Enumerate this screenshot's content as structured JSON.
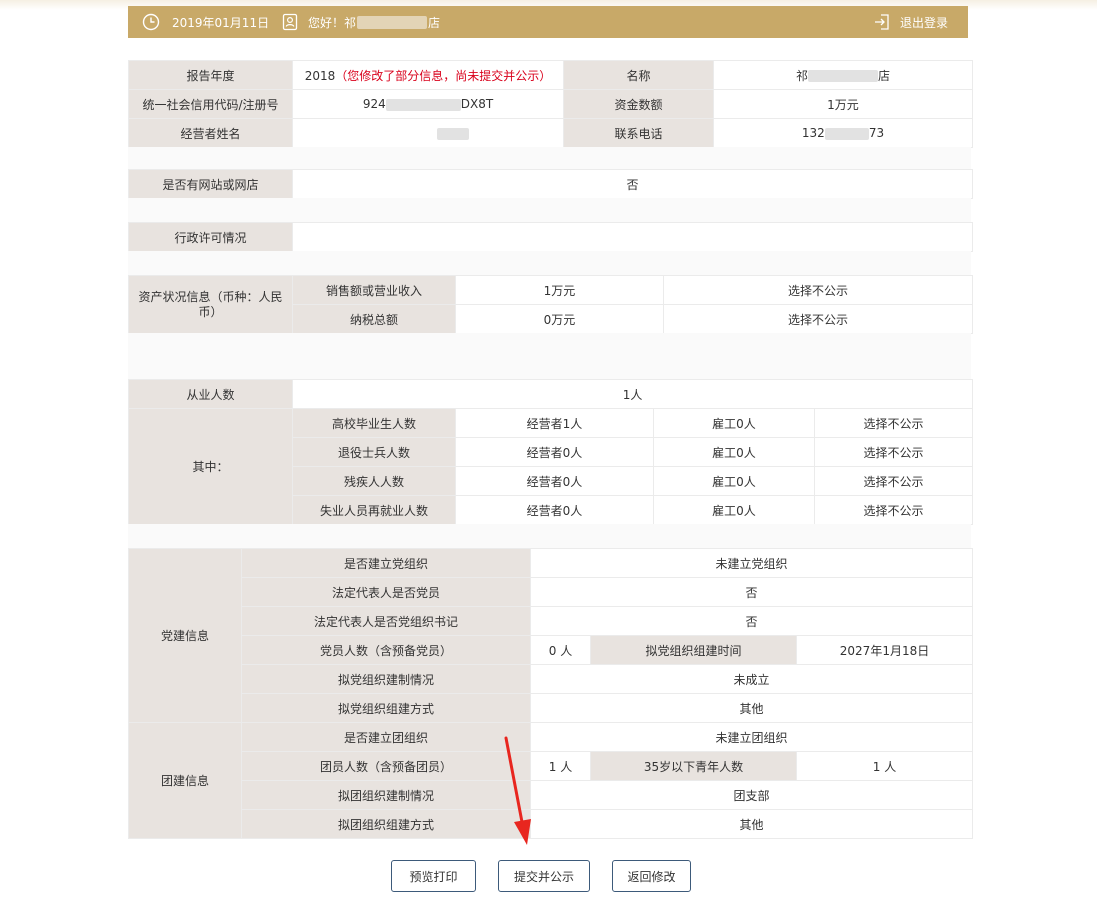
{
  "header": {
    "date": "2019年01月11日",
    "greeting_prefix": "您好！祁",
    "greeting_suffix": "店",
    "logout_label": "退出登录",
    "color": "#c8a968"
  },
  "basic": {
    "report_year_label": "报告年度",
    "report_year_value": "2018",
    "report_year_note": "（您修改了部分信息，尚未提交并公示）",
    "name_label": "名称",
    "name_prefix": "祁",
    "name_suffix": "店",
    "credit_code_label": "统一社会信用代码/注册号",
    "credit_code_prefix": "924",
    "credit_code_suffix": "DX8T",
    "capital_label": "资金数额",
    "capital_value": "1万元",
    "operator_label": "经营者姓名",
    "phone_label": "联系电话",
    "phone_prefix": "132",
    "phone_suffix": "73"
  },
  "website": {
    "label": "是否有网站或网店",
    "value": "否"
  },
  "license": {
    "label": "行政许可情况",
    "value": ""
  },
  "assets": {
    "label": "资产状况信息（币种：人民币）",
    "rows": [
      {
        "label": "销售额或营业收入",
        "value": "1万元",
        "publicity": "选择不公示"
      },
      {
        "label": "纳税总额",
        "value": "0万元",
        "publicity": "选择不公示"
      }
    ]
  },
  "employees": {
    "label": "从业人数",
    "value": "1人",
    "sub_label": "其中：",
    "rows": [
      {
        "label": "高校毕业生人数",
        "operator": "经营者1人",
        "staff": "雇工0人",
        "publicity": "选择不公示"
      },
      {
        "label": "退役士兵人数",
        "operator": "经营者0人",
        "staff": "雇工0人",
        "publicity": "选择不公示"
      },
      {
        "label": "残疾人人数",
        "operator": "经营者0人",
        "staff": "雇工0人",
        "publicity": "选择不公示"
      },
      {
        "label": "失业人员再就业人数",
        "operator": "经营者0人",
        "staff": "雇工0人",
        "publicity": "选择不公示"
      }
    ]
  },
  "party": {
    "label": "党建信息",
    "org_label": "是否建立党组织",
    "org_value": "未建立党组织",
    "rep_member_label": "法定代表人是否党员",
    "rep_member_value": "否",
    "rep_secretary_label": "法定代表人是否党组织书记",
    "rep_secretary_value": "否",
    "members_label": "党员人数（含预备党员）",
    "members_value": "0 人",
    "plan_time_label": "拟党组织组建时间",
    "plan_time_value": "2027年1月18日",
    "plan_structure_label": "拟党组织建制情况",
    "plan_structure_value": "未成立",
    "plan_method_label": "拟党组织组建方式",
    "plan_method_value": "其他"
  },
  "league": {
    "label": "团建信息",
    "org_label": "是否建立团组织",
    "org_value": "未建立团组织",
    "members_label": "团员人数（含预备团员）",
    "members_value": "1 人",
    "youth_label": "35岁以下青年人数",
    "youth_value": "1 人",
    "plan_structure_label": "拟团组织建制情况",
    "plan_structure_value": "团支部",
    "plan_method_label": "拟团组织组建方式",
    "plan_method_value": "其他"
  },
  "buttons": {
    "preview_print": "预览打印",
    "submit_publish": "提交并公示",
    "back_edit": "返回修改"
  },
  "colors": {
    "label_bg": "#e8e3df",
    "note_red": "#d9001b",
    "annotation_arrow": "#e8261f",
    "button_border": "#3d5a7a"
  }
}
